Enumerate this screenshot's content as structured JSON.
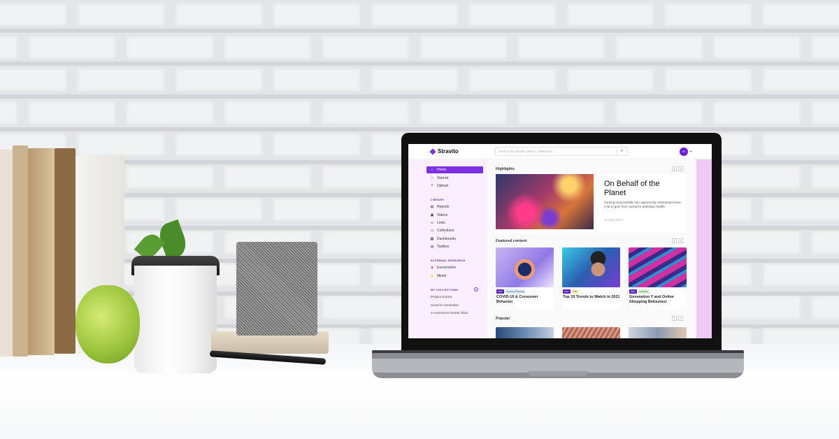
{
  "app": {
    "brand": "Stravito",
    "search_placeholder": "Search for reports, videos, collections...",
    "user_initials": "GC"
  },
  "sidebar": {
    "primary": [
      {
        "label": "Home",
        "icon": "home-icon",
        "active": true
      },
      {
        "label": "Starred",
        "icon": "star-icon"
      },
      {
        "label": "Upload",
        "icon": "upload-icon"
      }
    ],
    "library_label": "LIBRARY",
    "library": [
      {
        "label": "Reports",
        "icon": "report-icon"
      },
      {
        "label": "Videos",
        "icon": "video-icon"
      },
      {
        "label": "Links",
        "icon": "link-icon"
      },
      {
        "label": "Collections",
        "icon": "folder-icon"
      },
      {
        "label": "Dashboards",
        "icon": "dashboard-icon"
      },
      {
        "label": "Toolbox",
        "icon": "globe-icon"
      }
    ],
    "external_label": "EXTERNAL RESEARCH",
    "external": [
      {
        "label": "Euromonitor",
        "icon": "euromonitor-logo-icon"
      },
      {
        "label": "Mintel",
        "icon": "mintel-logo-icon"
      }
    ],
    "collections_label": "MY COLLECTIONS",
    "collections": [
      "Project Aurora",
      "Good to remember",
      "e-commerce trends 2021"
    ]
  },
  "highlights": {
    "section_title": "Highlights",
    "title": "On Behalf of the Planet",
    "description": "Turning responsibility into opportunity, enterprises have a lot to gain from caring for planetary health.",
    "date": "17 April 2021"
  },
  "featured": {
    "section_title": "Featured content",
    "cards": [
      {
        "badge": "NEW",
        "tag": "Strategy & Planning",
        "tag_color": "#d6ecff",
        "title": "COVID-19 & Consumer Behavior"
      },
      {
        "badge": "NEW",
        "tag": "R&D",
        "tag_color": "#ffefb5",
        "title": "Top 10 Trends to Watch in 2021"
      },
      {
        "badge": "NEW",
        "tag": "Marketing",
        "tag_color": "#d7f5d3",
        "title": "Generation Y and Online Shopping Behaviour"
      }
    ]
  },
  "popular": {
    "section_title": "Popular"
  },
  "nav": {
    "prev": "‹",
    "next": "›",
    "search_icon": "⌕",
    "caret": "▾",
    "plus": "+"
  },
  "colors": {
    "accent": "#7b2fe0",
    "sidebar_bg": "#fbeeff",
    "rail": "#f1c9f7"
  }
}
